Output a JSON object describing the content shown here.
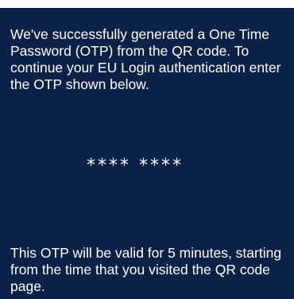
{
  "colors": {
    "panel_background": "#0b2147",
    "text": "#ffffff"
  },
  "message": {
    "intro": "We've successfully generated a One Time Password (OTP) from the QR code. To continue your EU Login authentication enter the OTP shown below.",
    "otp_masked": "**** ****",
    "validity": "This OTP will be valid for 5 minutes, starting from the time that you visited the QR code page."
  }
}
